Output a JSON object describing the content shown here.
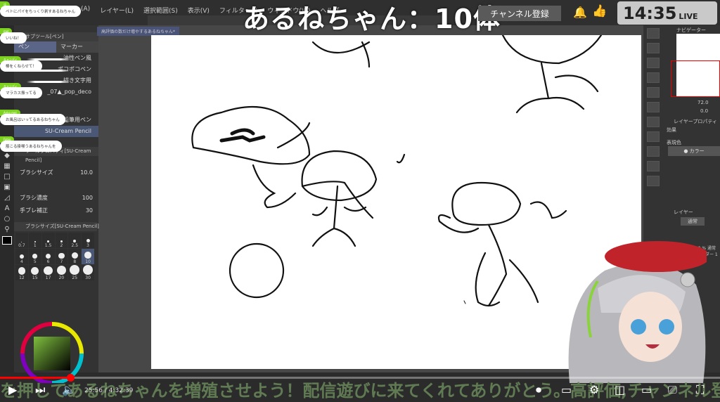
{
  "overlay": {
    "title": "あるねちゃん：10体",
    "subscribe_label": "チャンネル登録",
    "clock": "14:35",
    "live": "LIVE"
  },
  "app": {
    "menu": [
      "(A)",
      "レイヤー(L)",
      "選択範囲(S)",
      "表示(V)",
      "フィルター(I)",
      "ウィンドウ(W)",
      "ヘルプ"
    ],
    "document_tab": "高評価の数だけ増やするあるねちゃん*",
    "left": {
      "subtool_tab": "サブツール[ペン]",
      "subtool_groups": [
        "ペン",
        "マーカー"
      ],
      "brushes": [
        "油性ペン風",
        "ポコポコペン",
        "描き文字用",
        "_07▲_pop_deco",
        "鉛筆用ペン",
        "SU-Cream Pencil"
      ],
      "tool_property_tab": "ツールプロパティ[SU-Cream Pencil]",
      "props": [
        {
          "label": "ブラシサイズ",
          "value": "10.0"
        },
        {
          "label": "ブラシ濃度",
          "value": "100"
        },
        {
          "label": "手ブレ補正",
          "value": "30"
        }
      ],
      "brush_size_tab": "ブラシサイズ[SU-Cream Pencil]",
      "sizes": [
        "0.7",
        "1",
        "1.5",
        "2",
        "2.5",
        "3",
        "4",
        "5",
        "6",
        "7",
        "8",
        "10",
        "12",
        "15",
        "17",
        "20",
        "25",
        "30"
      ],
      "selected_size": "10"
    },
    "right": {
      "navigator_tab": "ナビゲーター",
      "zoom": "72.0",
      "rotate": "0.0",
      "layer_property_tab": "レイヤープロパティ",
      "effect_label": "効果",
      "expression_label": "表現色",
      "color_label": "カラー",
      "layer_tab": "レイヤー",
      "blend_mode": "通常",
      "layer_name": "100 % 通常\nフォルダー 1"
    }
  },
  "chat": [
    {
      "user": "ゆ",
      "message": "ペトにパイをちっくり剥すあるねちゃん"
    },
    {
      "user": "mel",
      "message": "いいね！"
    },
    {
      "user": "キャンディ",
      "message": "棒をくねらせて！"
    },
    {
      "user": "キャンディ",
      "message": "マラカス振ってる"
    },
    {
      "user": "Anko mel",
      "message": "お風呂はいってるあるねちゃん"
    },
    {
      "user": "Fabio",
      "message": "筋こる掛喉うあるねちゃんを"
    }
  ],
  "player": {
    "current_time": "25:56",
    "duration": "4:32:39",
    "progress_percent": 9.8,
    "ticker": "を押してあるねちゃんを増殖させよう！配信遊びに来てくれてありがとう。高評価,チャンネル登録"
  }
}
